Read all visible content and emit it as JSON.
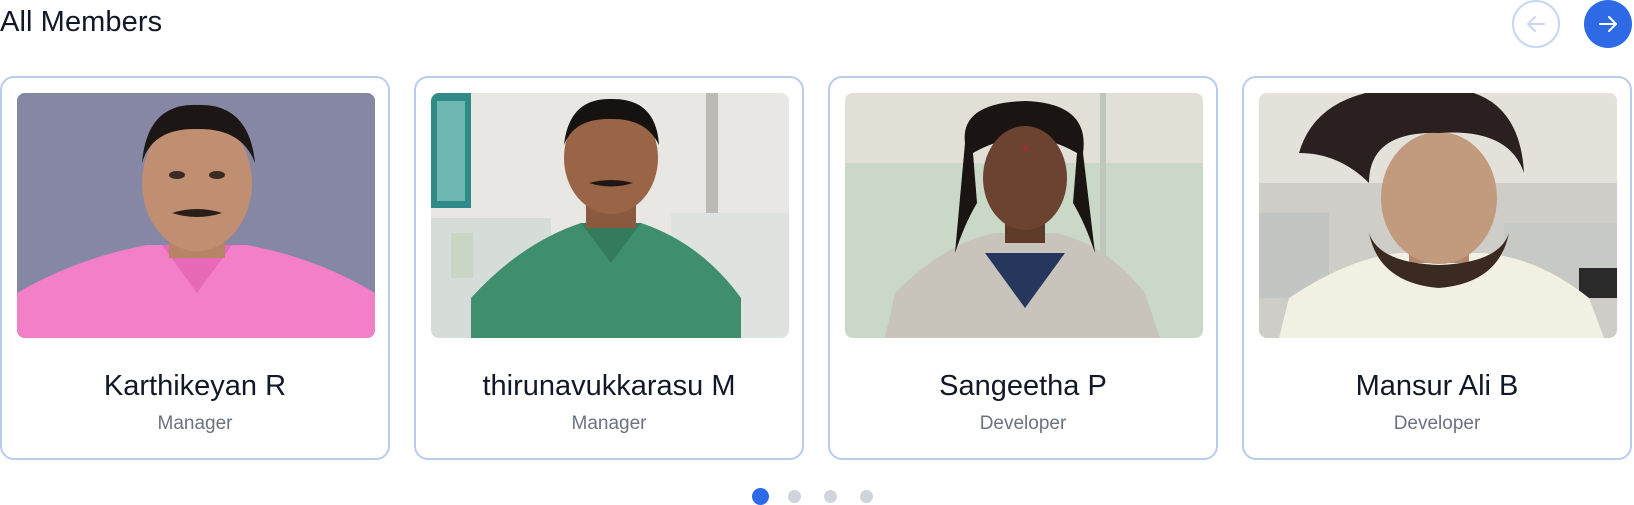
{
  "section": {
    "title": "All Members"
  },
  "navigation": {
    "prev_icon": "arrow-left-icon",
    "next_icon": "arrow-right-icon",
    "prev_color": "#c7d6f5",
    "next_color": "#2f6ae6"
  },
  "members": [
    {
      "name": "Karthikeyan R",
      "role": "Manager",
      "photo_icon": "member-photo"
    },
    {
      "name": "thirunavukkarasu M",
      "role": "Manager",
      "photo_icon": "member-photo"
    },
    {
      "name": "Sangeetha P",
      "role": "Developer",
      "photo_icon": "member-photo"
    },
    {
      "name": "Mansur Ali B",
      "role": "Developer",
      "photo_icon": "member-photo"
    }
  ],
  "pagination": {
    "count": 4,
    "active_index": 0
  },
  "colors": {
    "accent": "#2f6ae6",
    "card_border": "#b8ccef",
    "dot_inactive": "#d1d5db",
    "role_text": "#6b7280"
  }
}
